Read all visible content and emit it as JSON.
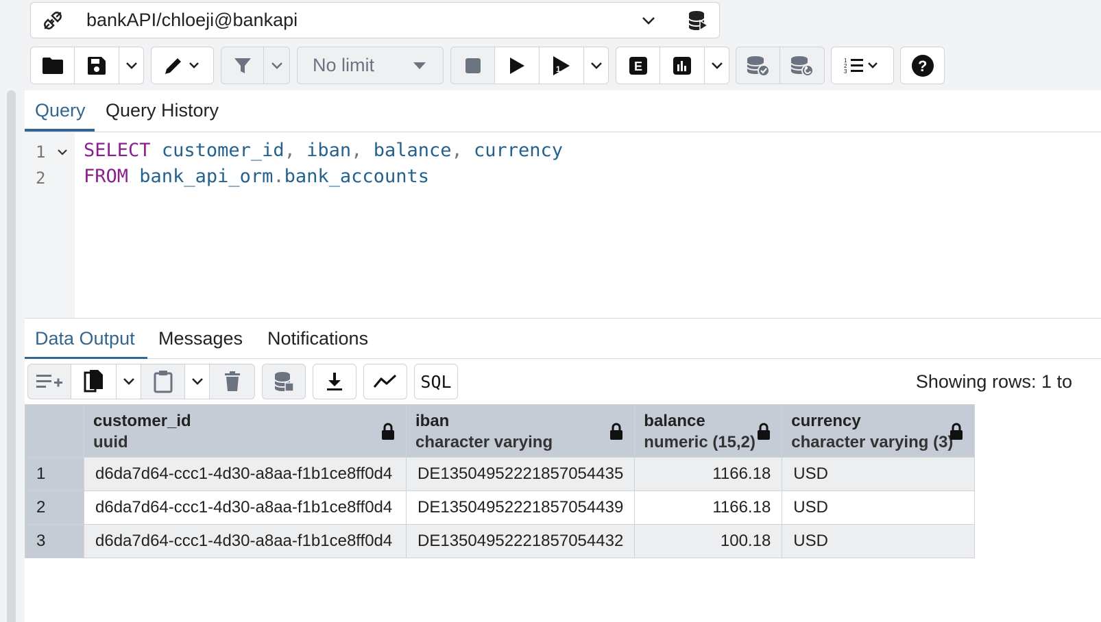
{
  "connection": {
    "label": "bankAPI/chloeji@bankapi"
  },
  "toolbar": {
    "limit_value": "No limit"
  },
  "editor": {
    "tabs": [
      "Query",
      "Query History"
    ],
    "line_numbers": [
      "1",
      "2"
    ],
    "lines": [
      {
        "kw": "SELECT",
        "rest": [
          {
            "t": "customer_id",
            "c": "id"
          },
          {
            "t": ", ",
            "c": "punc"
          },
          {
            "t": "iban",
            "c": "id"
          },
          {
            "t": ", ",
            "c": "punc"
          },
          {
            "t": "balance",
            "c": "id"
          },
          {
            "t": ", ",
            "c": "punc"
          },
          {
            "t": "currency",
            "c": "id"
          }
        ]
      },
      {
        "kw": "FROM",
        "rest": [
          {
            "t": "bank_api_orm",
            "c": "id"
          },
          {
            "t": ".",
            "c": "punc"
          },
          {
            "t": "bank_accounts",
            "c": "id"
          }
        ]
      }
    ]
  },
  "output": {
    "tabs": [
      "Data Output",
      "Messages",
      "Notifications"
    ],
    "status": "Showing rows: 1 to",
    "sql_label": "SQL",
    "columns": [
      {
        "name": "customer_id",
        "type": "uuid"
      },
      {
        "name": "iban",
        "type": "character varying"
      },
      {
        "name": "balance",
        "type": "numeric (15,2)"
      },
      {
        "name": "currency",
        "type": "character varying (3)"
      }
    ],
    "rows": [
      {
        "n": "1",
        "customer_id": "d6da7d64-ccc1-4d30-a8aa-f1b1ce8ff0d4",
        "iban": "DE13504952221857054435",
        "balance": "1166.18",
        "currency": "USD"
      },
      {
        "n": "2",
        "customer_id": "d6da7d64-ccc1-4d30-a8aa-f1b1ce8ff0d4",
        "iban": "DE13504952221857054439",
        "balance": "1166.18",
        "currency": "USD"
      },
      {
        "n": "3",
        "customer_id": "d6da7d64-ccc1-4d30-a8aa-f1b1ce8ff0d4",
        "iban": "DE13504952221857054432",
        "balance": "100.18",
        "currency": "USD"
      }
    ]
  },
  "colors": {
    "accent": "#326690",
    "keyword": "#8a1f8f",
    "identifier": "#23628f",
    "header_bg": "#c6ccd5"
  }
}
